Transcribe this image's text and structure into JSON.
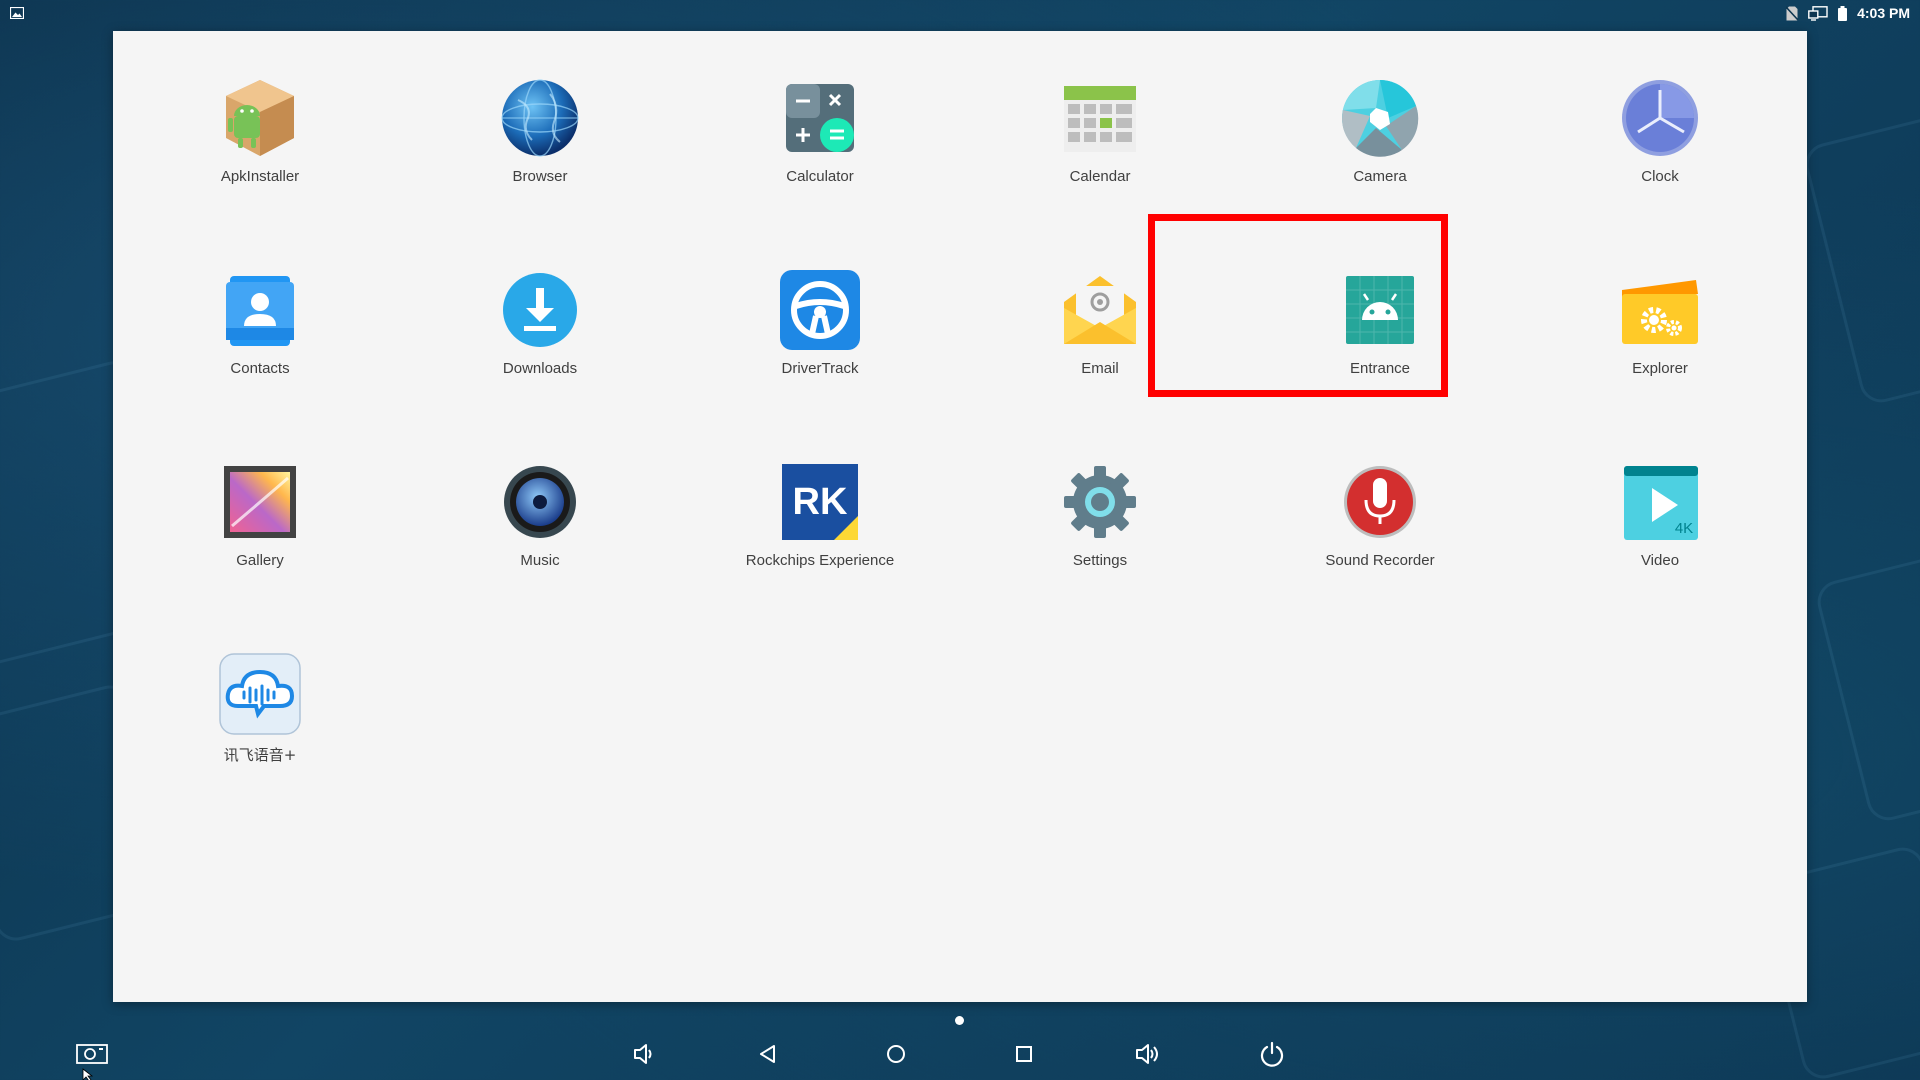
{
  "status_bar": {
    "time": "4:03 PM",
    "icons": [
      "gallery-notification-icon",
      "no-sim-icon",
      "cast-screen-icon",
      "battery-icon"
    ]
  },
  "apps": [
    {
      "label": "ApkInstaller",
      "icon": "apk-installer-icon"
    },
    {
      "label": "Browser",
      "icon": "globe-icon"
    },
    {
      "label": "Calculator",
      "icon": "calculator-icon"
    },
    {
      "label": "Calendar",
      "icon": "calendar-icon"
    },
    {
      "label": "Camera",
      "icon": "camera-aperture-icon"
    },
    {
      "label": "Clock",
      "icon": "clock-icon"
    },
    {
      "label": "Contacts",
      "icon": "contacts-icon"
    },
    {
      "label": "Downloads",
      "icon": "download-icon"
    },
    {
      "label": "DriverTrack",
      "icon": "steering-wheel-icon"
    },
    {
      "label": "Email",
      "icon": "email-icon"
    },
    {
      "label": "Entrance",
      "icon": "android-icon"
    },
    {
      "label": "Explorer",
      "icon": "folder-gear-icon"
    },
    {
      "label": "Gallery",
      "icon": "gallery-icon"
    },
    {
      "label": "Music",
      "icon": "speaker-icon"
    },
    {
      "label": "Rockchips Experience",
      "icon": "rk-logo-icon"
    },
    {
      "label": "Settings",
      "icon": "gear-icon"
    },
    {
      "label": "Sound Recorder",
      "icon": "microphone-icon"
    },
    {
      "label": "Video",
      "icon": "video-play-icon"
    },
    {
      "label": "讯飞语音+",
      "icon": "voice-cloud-icon"
    }
  ],
  "icon_text": {
    "video_badge": "4K",
    "rk_logo": "RK"
  },
  "highlighted_app": "Entrance",
  "colors": {
    "highlight": "#ff0000",
    "drawer_bg": "#f5f5f5",
    "label": "#404040"
  },
  "nav_bar": [
    "screenshot-icon",
    "volume-down-icon",
    "back-icon",
    "home-icon",
    "recents-icon",
    "volume-up-icon",
    "power-icon"
  ]
}
